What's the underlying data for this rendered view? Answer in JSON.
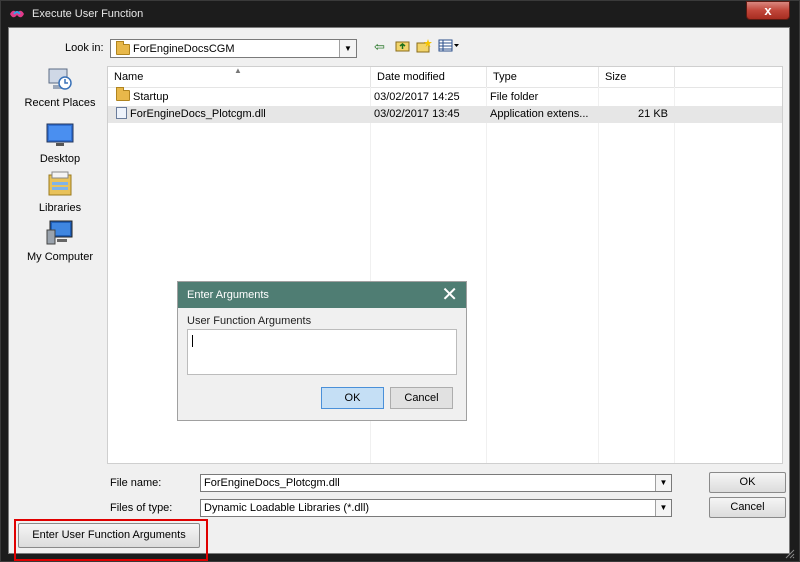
{
  "window": {
    "title": "Execute User Function",
    "close_glyph": "x"
  },
  "toolbar": {
    "look_in_label": "Look in:",
    "look_in_value": "ForEngineDocsCGM",
    "back_icon": "back-arrow-icon",
    "up_icon": "up-folder-icon",
    "new_folder_icon": "new-folder-icon",
    "view_menu_icon": "view-menu-icon"
  },
  "places": [
    {
      "label": "Recent Places",
      "icon": "recent-places-icon"
    },
    {
      "label": "Desktop",
      "icon": "desktop-icon"
    },
    {
      "label": "Libraries",
      "icon": "libraries-icon"
    },
    {
      "label": "My Computer",
      "icon": "my-computer-icon"
    }
  ],
  "file_list": {
    "columns": [
      "Name",
      "Date modified",
      "Type",
      "Size"
    ],
    "rows": [
      {
        "name": "Startup",
        "date": "03/02/2017 14:25",
        "type": "File folder",
        "size": "",
        "icon": "folder-icon"
      },
      {
        "name": "ForEngineDocs_Plotcgm.dll",
        "date": "03/02/2017 13:45",
        "type": "Application extens...",
        "size": "21 KB",
        "icon": "dll-file-icon"
      }
    ]
  },
  "file_name": {
    "label": "File name:",
    "value": "ForEngineDocs_Plotcgm.dll"
  },
  "files_of_type": {
    "label": "Files of type:",
    "value": "Dynamic Loadable Libraries (*.dll)"
  },
  "buttons": {
    "ok": "OK",
    "cancel": "Cancel",
    "enter_args": "Enter User Function Arguments"
  },
  "args_dialog": {
    "title": "Enter Arguments",
    "close_glyph": "✕",
    "label": "User Function Arguments",
    "value": "",
    "ok": "OK",
    "cancel": "Cancel"
  },
  "colors": {
    "highlight": "#e00000",
    "dialog_title_bar": "#4f7d73",
    "ok_focus": "#c5dff5"
  }
}
